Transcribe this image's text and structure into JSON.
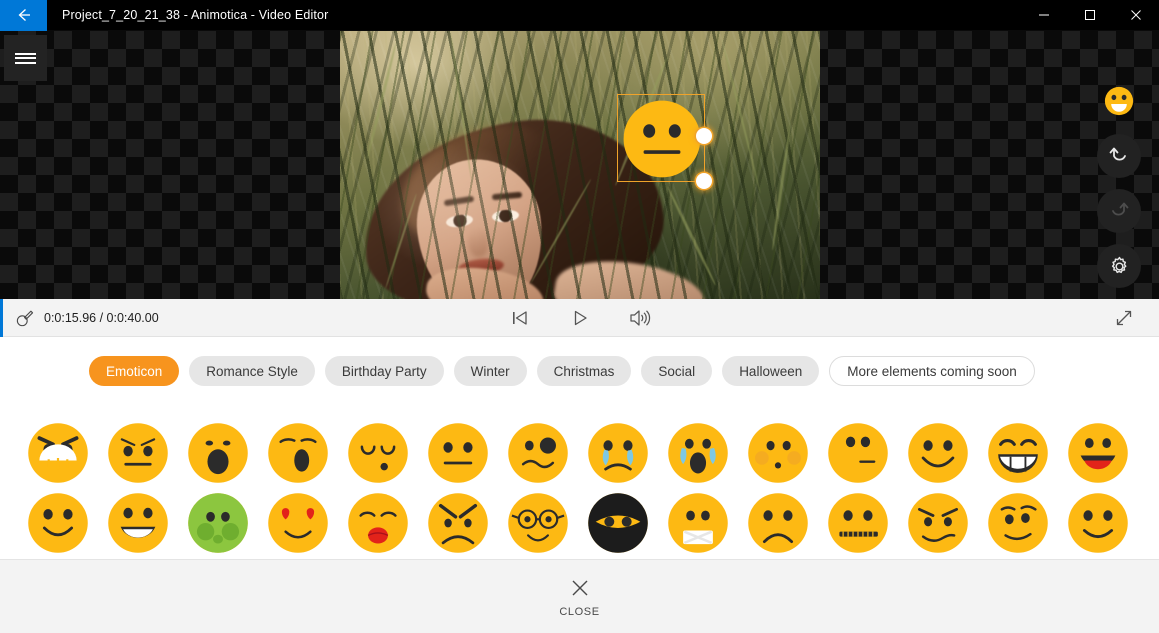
{
  "window": {
    "title": "Project_7_20_21_38 - Animotica - Video Editor",
    "back_icon": "back-arrow-icon",
    "minimize_label": "minimize-icon",
    "maximize_label": "maximize-icon",
    "close_label": "close-icon"
  },
  "stage": {
    "menu_icon": "hamburger-menu-icon",
    "overlay": {
      "emoji": "neutral-face-emoji",
      "handle_right": "resize-handle-right",
      "handle_corner": "resize-handle-bottom-right"
    }
  },
  "rail": {
    "items": [
      {
        "name": "emoticon-tool",
        "icon": "smiley-icon",
        "active": true
      },
      {
        "name": "undo-button",
        "icon": "undo-arrow-icon",
        "active": false
      },
      {
        "name": "redo-button",
        "icon": "redo-arrow-icon",
        "active": false
      },
      {
        "name": "settings-button",
        "icon": "gear-icon",
        "active": false
      }
    ]
  },
  "transport": {
    "tool_icon": "brush-tool-icon",
    "current_time": "0:0:15.96",
    "separator": "/",
    "total_time": "0:0:40.00",
    "time_display": "0:0:15.96 / 0:0:40.00",
    "skip_start_label": "skip-to-start-icon",
    "play_label": "play-icon",
    "volume_label": "volume-icon",
    "fullscreen_label": "fullscreen-expand-icon"
  },
  "tabs": [
    {
      "label": "Emoticon",
      "active": true,
      "outline": false
    },
    {
      "label": "Romance Style",
      "active": false,
      "outline": false
    },
    {
      "label": "Birthday Party",
      "active": false,
      "outline": false
    },
    {
      "label": "Winter",
      "active": false,
      "outline": false
    },
    {
      "label": "Christmas",
      "active": false,
      "outline": false
    },
    {
      "label": "Social",
      "active": false,
      "outline": false
    },
    {
      "label": "Halloween",
      "active": false,
      "outline": false
    },
    {
      "label": "More elements coming soon",
      "active": false,
      "outline": true
    }
  ],
  "emoji_grid": {
    "columns": 14,
    "items": [
      {
        "name": "angry-grin-emoji",
        "type": "angry-grin"
      },
      {
        "name": "angry-emoji",
        "type": "angry-flat"
      },
      {
        "name": "shocked-emoji",
        "type": "shocked"
      },
      {
        "name": "yawning-emoji",
        "type": "yawning"
      },
      {
        "name": "sleepy-emoji",
        "type": "sleepy"
      },
      {
        "name": "neutral-emoji",
        "type": "neutral"
      },
      {
        "name": "confused-wink-emoji",
        "type": "confused-wink"
      },
      {
        "name": "crying-emoji",
        "type": "crying"
      },
      {
        "name": "sobbing-emoji",
        "type": "sobbing"
      },
      {
        "name": "blushing-emoji",
        "type": "blushing"
      },
      {
        "name": "smirk-emoji",
        "type": "smirk-flat"
      },
      {
        "name": "smile-emoji",
        "type": "smile"
      },
      {
        "name": "grinning-teeth-emoji",
        "type": "grinning-teeth"
      },
      {
        "name": "laughing-emoji",
        "type": "laughing"
      },
      {
        "name": "slight-smile-emoji",
        "type": "slight-smile"
      },
      {
        "name": "open-mouth-smile-emoji",
        "type": "open-mouth-smile"
      },
      {
        "name": "nauseated-green-emoji",
        "type": "nauseated-green"
      },
      {
        "name": "heart-eyes-emoji",
        "type": "heart-eyes"
      },
      {
        "name": "kissing-emoji",
        "type": "kissing"
      },
      {
        "name": "rage-emoji",
        "type": "rage"
      },
      {
        "name": "nerd-glasses-emoji",
        "type": "nerd-glasses"
      },
      {
        "name": "ninja-emoji",
        "type": "ninja"
      },
      {
        "name": "bandaged-mouth-emoji",
        "type": "bandaged-mouth"
      },
      {
        "name": "sad-emoji",
        "type": "sad"
      },
      {
        "name": "zipper-mouth-emoji",
        "type": "zipper-mouth"
      },
      {
        "name": "sly-emoji",
        "type": "sly"
      },
      {
        "name": "raised-eyebrow-emoji",
        "type": "raised-eyebrow"
      },
      {
        "name": "happy-emoji",
        "type": "happy"
      }
    ]
  },
  "footer": {
    "close_icon": "close-x-icon",
    "close_label": "CLOSE"
  },
  "colors": {
    "accent_orange": "#f7941e",
    "emoji_yellow": "#fdb913",
    "title_bar": "#000000",
    "window_accent_blue": "#0078d7",
    "toolbar_bg": "#f3f3f3",
    "tab_bg": "#e6e6e6"
  }
}
